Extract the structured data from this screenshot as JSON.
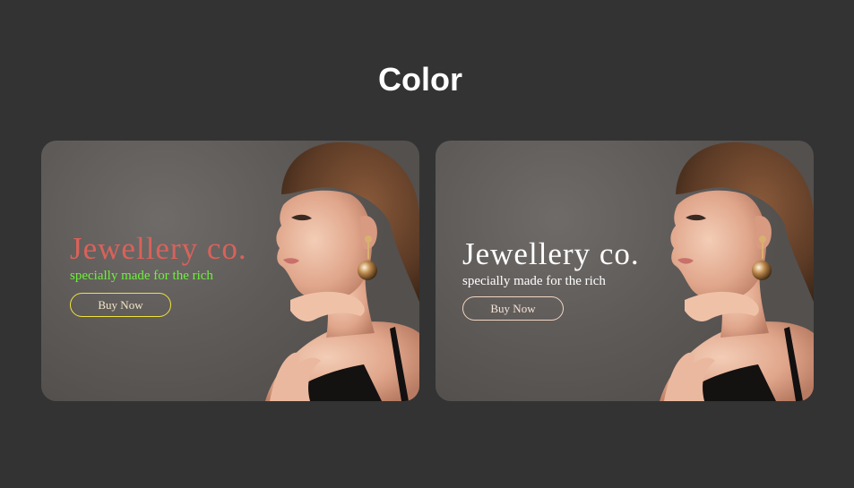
{
  "page": {
    "title": "Color"
  },
  "cards": [
    {
      "headline": "Jewellery co.",
      "tagline": "specially made for the rich",
      "button_label": "Buy Now",
      "colors": {
        "headline": "#d9625a",
        "tagline": "#6cf23a",
        "button_border": "#f2e33a",
        "button_text": "#f2e6c8"
      }
    },
    {
      "headline": "Jewellery co.",
      "tagline": "specially made for the rich",
      "button_label": "Buy Now",
      "colors": {
        "headline": "#ffffff",
        "tagline": "#ffffff",
        "button_border": "#f2d6c0",
        "button_text": "#f4e4d6"
      }
    }
  ]
}
